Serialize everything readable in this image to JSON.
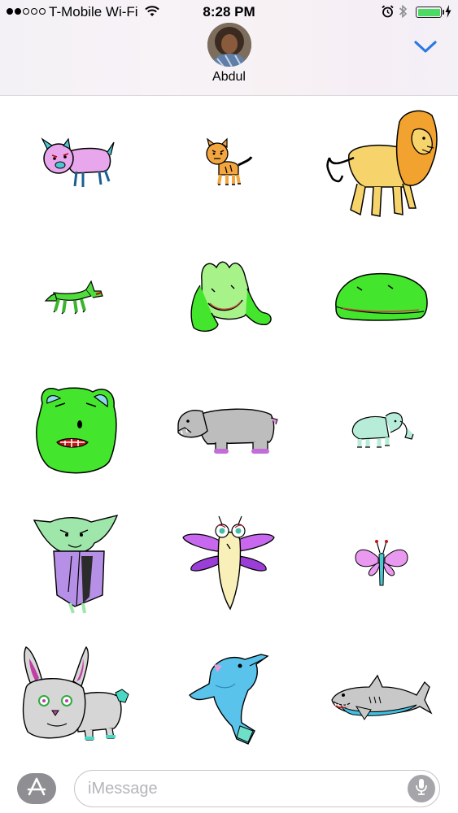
{
  "status_bar": {
    "signal_bars_filled": 2,
    "signal_bars_total": 5,
    "carrier": "T-Mobile Wi-Fi",
    "time": "8:28 PM",
    "battery_level": 1.0
  },
  "conversation": {
    "contact_name": "Abdul"
  },
  "stickers": [
    {
      "name": "pink-pig-sticker"
    },
    {
      "name": "tiger-cub-sticker"
    },
    {
      "name": "lion-sticker"
    },
    {
      "name": "green-fox-sticker"
    },
    {
      "name": "green-frog-sticker"
    },
    {
      "name": "green-blob-sticker"
    },
    {
      "name": "green-monster-face-sticker"
    },
    {
      "name": "hippo-sticker"
    },
    {
      "name": "baby-elephant-sticker"
    },
    {
      "name": "goblin-cloak-sticker"
    },
    {
      "name": "dragonfly-sticker"
    },
    {
      "name": "butterfly-sticker"
    },
    {
      "name": "bunny-sticker"
    },
    {
      "name": "dolphin-sticker"
    },
    {
      "name": "shark-sticker"
    }
  ],
  "composer": {
    "placeholder": "iMessage"
  },
  "colors": {
    "accent_blue": "#2a7ae2",
    "battery_green": "#4cd964"
  }
}
